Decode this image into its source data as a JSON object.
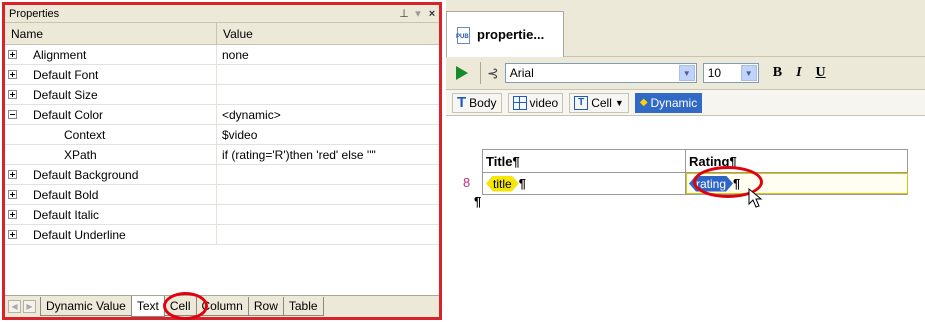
{
  "properties_panel": {
    "title": "Properties",
    "pin_icon": "pin-icon",
    "columns": {
      "name": "Name",
      "value": "Value"
    },
    "rows": [
      {
        "name": "Alignment",
        "value": "none",
        "expander": "plus"
      },
      {
        "name": "Default Font",
        "value": "",
        "expander": "plus"
      },
      {
        "name": "Default Size",
        "value": "",
        "expander": "plus"
      },
      {
        "name": "Default Color",
        "value": "<dynamic>",
        "expander": "minus"
      },
      {
        "name": "Context",
        "value": "$video",
        "expander": "none"
      },
      {
        "name": "XPath",
        "value": "if (rating='R')then 'red' else ''\"",
        "expander": "none"
      },
      {
        "name": "Default Background",
        "value": "",
        "expander": "plus"
      },
      {
        "name": "Default Bold",
        "value": "",
        "expander": "plus"
      },
      {
        "name": "Default Italic",
        "value": "",
        "expander": "plus"
      },
      {
        "name": "Default Underline",
        "value": "",
        "expander": "plus"
      }
    ],
    "tabs": [
      "Dynamic Value",
      "Text",
      "Cell",
      "Column",
      "Row",
      "Table"
    ],
    "active_tab": "Text"
  },
  "editor": {
    "document_tab": "propertie...",
    "toolbar": {
      "font": "Arial",
      "size": "10",
      "bold": "B",
      "italic": "I",
      "underline": "U"
    },
    "breadcrumbs": [
      {
        "label": "Body",
        "icon": "text-icon"
      },
      {
        "label": "video",
        "icon": "table-icon"
      },
      {
        "label": "Cell",
        "icon": "cell-icon",
        "dropdown": "▼"
      },
      {
        "label": "Dynamic",
        "icon": "diamond-icon",
        "selected": true
      }
    ],
    "table": {
      "headers": [
        "Title¶",
        "Rating¶"
      ],
      "title_field": "title",
      "rating_field": "rating",
      "pilcrow": "¶"
    }
  },
  "colors": {
    "highlight_red": "#e00010",
    "selection_blue": "#316ac5",
    "field_yellow": "#f5e60a"
  }
}
